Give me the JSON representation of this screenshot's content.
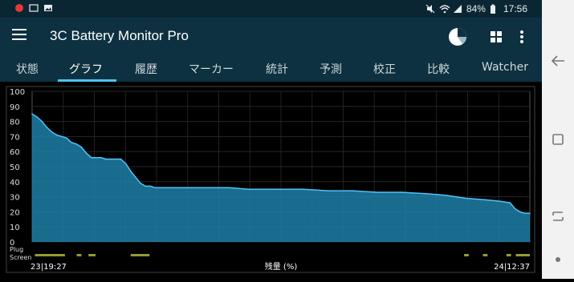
{
  "status_bar": {
    "battery": "84%",
    "time": "17:56",
    "icons": [
      "notification-icon",
      "photo-icon",
      "image-icon",
      "mute-icon",
      "wifi-icon",
      "signal-icon",
      "battery-icon"
    ]
  },
  "toolbar": {
    "title": "3C Battery Monitor Pro",
    "icons": [
      "menu-icon",
      "pie-chart-icon",
      "grid-icon",
      "more-vert-icon"
    ]
  },
  "tabs": [
    {
      "label": "状態"
    },
    {
      "label": "グラフ",
      "active": true
    },
    {
      "label": "履歴"
    },
    {
      "label": "マーカー"
    },
    {
      "label": "統計"
    },
    {
      "label": "予測"
    },
    {
      "label": "校正"
    },
    {
      "label": "比較"
    },
    {
      "label": "Watcher"
    }
  ],
  "nav_bar": {
    "icons": [
      "back-icon",
      "recents-icon",
      "home-icon",
      "dot-icon"
    ]
  },
  "chart_data": {
    "type": "area",
    "xlabel": "残量 (%)",
    "x_start_label": "23|19:27",
    "x_end_label": "24|12:37",
    "ylim": [
      0,
      100
    ],
    "yticks": [
      0,
      10,
      20,
      30,
      40,
      50,
      60,
      70,
      80,
      90,
      100
    ],
    "grid": true,
    "color": "#1f7fa8",
    "line_color": "#4fc3f7",
    "series": [
      {
        "values": [
          [
            0,
            85
          ],
          [
            1,
            83
          ],
          [
            2,
            80
          ],
          [
            3,
            76
          ],
          [
            4,
            73
          ],
          [
            5,
            71
          ],
          [
            6,
            70
          ],
          [
            7,
            69
          ],
          [
            8,
            66
          ],
          [
            9,
            65
          ],
          [
            10,
            63
          ],
          [
            11,
            59
          ],
          [
            12,
            56
          ],
          [
            13,
            56
          ],
          [
            14,
            56
          ],
          [
            15,
            55
          ],
          [
            16,
            55
          ],
          [
            17,
            55
          ],
          [
            18,
            55
          ],
          [
            19,
            52
          ],
          [
            20,
            47
          ],
          [
            21,
            43
          ],
          [
            22,
            39
          ],
          [
            23,
            37
          ],
          [
            24,
            37
          ],
          [
            25,
            36
          ],
          [
            30,
            36
          ],
          [
            35,
            36
          ],
          [
            40,
            36
          ],
          [
            44,
            35
          ],
          [
            50,
            35
          ],
          [
            55,
            35
          ],
          [
            60,
            34
          ],
          [
            65,
            34
          ],
          [
            70,
            33
          ],
          [
            75,
            33
          ],
          [
            80,
            32
          ],
          [
            84,
            31
          ],
          [
            88,
            29
          ],
          [
            92,
            28
          ],
          [
            95,
            27
          ],
          [
            97,
            26
          ],
          [
            98,
            22
          ],
          [
            99,
            20
          ],
          [
            100,
            19
          ],
          [
            101,
            19
          ]
        ]
      }
    ],
    "rows": [
      {
        "label": "Plug",
        "segments": []
      },
      {
        "label": "Screen",
        "segments": [
          [
            0.6,
            7.0
          ],
          [
            9.5,
            10.5
          ],
          [
            12.0,
            13.5
          ],
          [
            21.0,
            25.0
          ],
          [
            92.0,
            93.0
          ],
          [
            96.0,
            97.0
          ],
          [
            101.0,
            102.0
          ],
          [
            103.0,
            106.0
          ]
        ]
      }
    ]
  }
}
